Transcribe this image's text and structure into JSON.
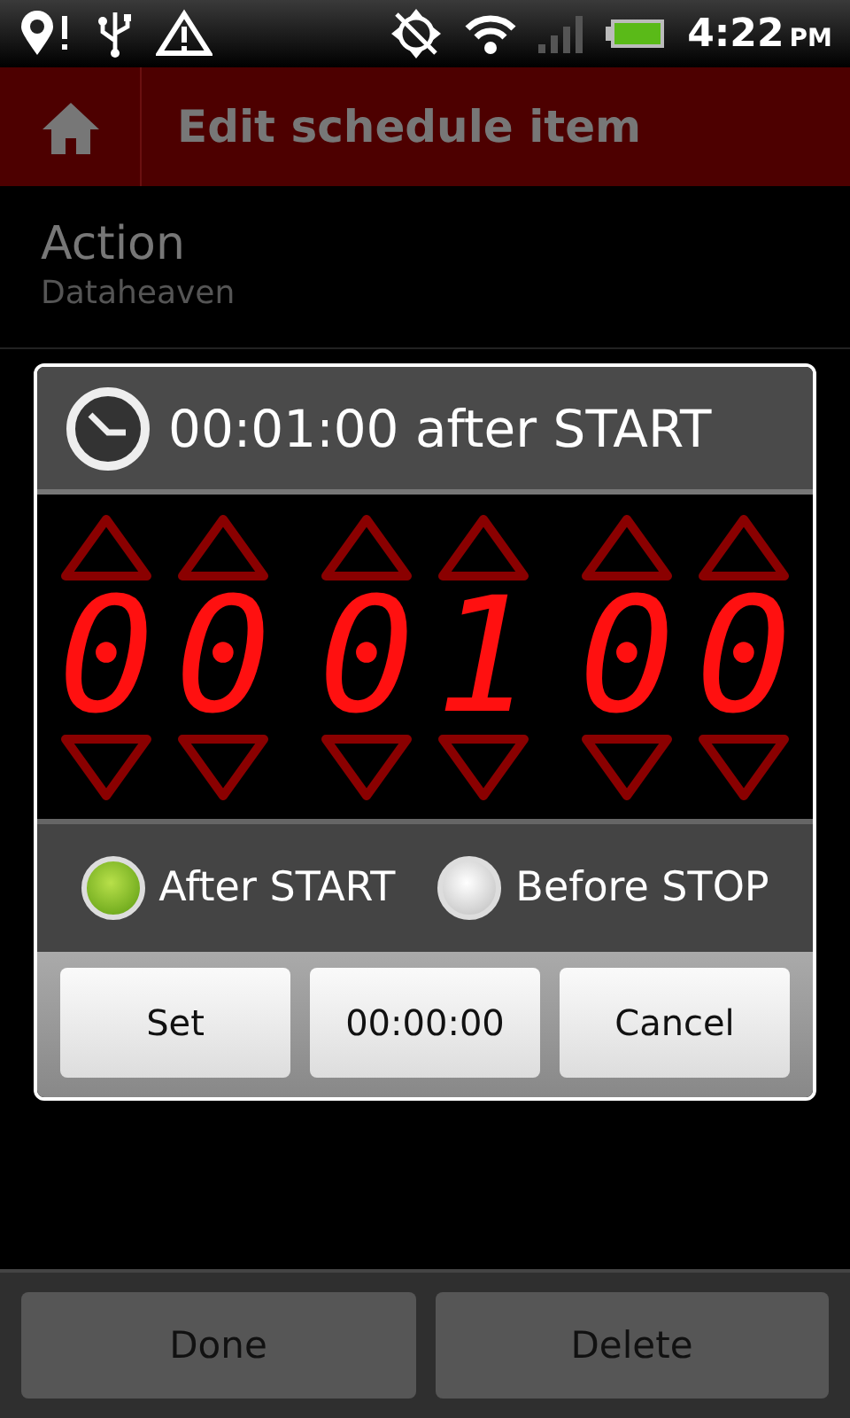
{
  "status_bar": {
    "time": "4:22",
    "ampm": "PM"
  },
  "action_bar": {
    "title": "Edit schedule item"
  },
  "settings": [
    {
      "title": "Action",
      "summary": "Dataheaven"
    }
  ],
  "dialog": {
    "title": "00:01:00 after START",
    "digits": [
      {
        "value": "0"
      },
      {
        "value": "0"
      },
      {
        "value": "0"
      },
      {
        "value": "1"
      },
      {
        "value": "0"
      },
      {
        "value": "0"
      }
    ],
    "radios": [
      {
        "label": "After START",
        "selected": true
      },
      {
        "label": "Before STOP",
        "selected": false
      }
    ],
    "buttons": [
      "Set",
      "00:00:00",
      "Cancel"
    ]
  },
  "bottom_buttons": [
    "Done",
    "Delete"
  ]
}
